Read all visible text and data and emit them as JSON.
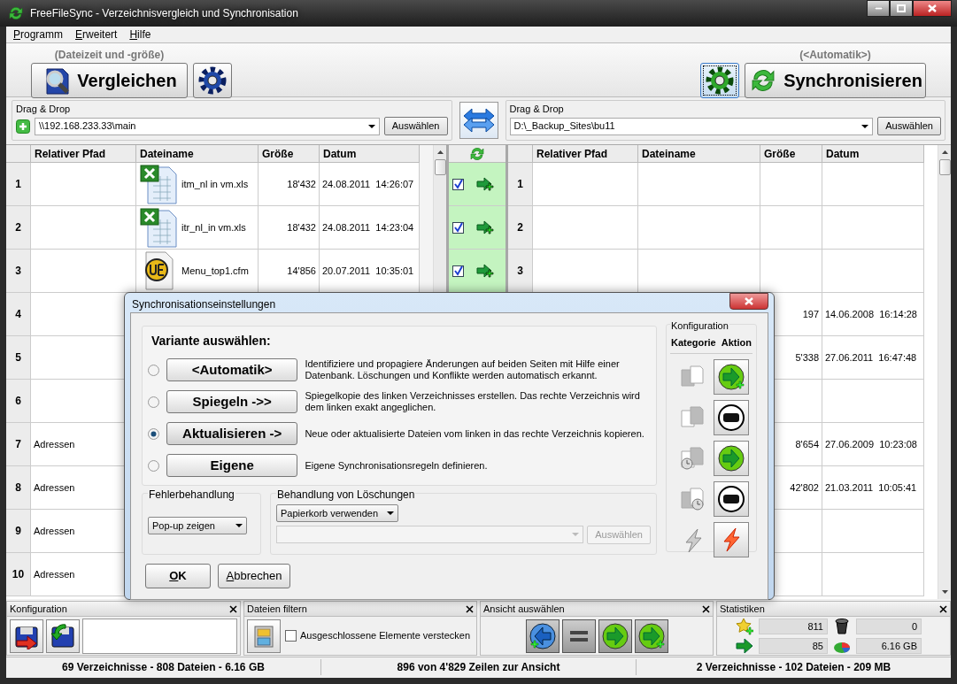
{
  "window": {
    "title": "FreeFileSync - Verzeichnisvergleich und Synchronisation"
  },
  "menu": [
    {
      "label": "Programm"
    },
    {
      "label": "Erweitert"
    },
    {
      "label": "Hilfe"
    }
  ],
  "toolbar": {
    "compare_hint": "(Dateizeit und -größe)",
    "compare_button": "Vergleichen",
    "sync_hint": "(<Automatik>)",
    "sync_button": "Synchronisieren"
  },
  "folders": {
    "left": {
      "label": "Drag & Drop",
      "path": "\\\\192.168.233.33\\main",
      "button": "Auswählen"
    },
    "right": {
      "label": "Drag & Drop",
      "path": "D:\\_Backup_Sites\\bu11",
      "button": "Auswählen"
    }
  },
  "grid": {
    "left_columns": [
      "Relativer Pfad",
      "Dateiname",
      "Größe",
      "Datum"
    ],
    "right_columns": [
      "Relativer Pfad",
      "Dateiname",
      "Größe",
      "Datum"
    ],
    "rows": [
      {
        "left_number": "1",
        "file_icon": {
          "kind": "excel"
        },
        "file_name": "itm_nl in vm.xls",
        "size": "18'432",
        "date": "24.08.2011  14:26:07",
        "checked": true,
        "action": {
          "kind": "create-right"
        },
        "right_number": "1"
      },
      {
        "left_number": "2",
        "file_icon": {
          "kind": "excel"
        },
        "file_name": "itr_nl_in vm.xls",
        "size": "18'432",
        "date": "24.08.2011  14:23:04",
        "checked": true,
        "action": {
          "kind": "create-right"
        },
        "right_number": "2"
      },
      {
        "left_number": "3",
        "file_icon": {
          "kind": "ultraedit"
        },
        "file_name": "Menu_top1.cfm",
        "size": "14'856",
        "date": "20.07.2011  10:35:01",
        "checked": true,
        "action": {
          "kind": "create-right"
        },
        "right_number": "3"
      },
      {
        "left_number": "4",
        "right_size": "197",
        "right_date": "14.06.2008  16:14:28"
      },
      {
        "left_number": "5",
        "right_size": "5'338",
        "right_date": "27.06.2011  16:47:48"
      },
      {
        "left_number": "6"
      },
      {
        "left_number": "7",
        "left_path": "Adressen",
        "right_size": "8'654",
        "right_date": "27.06.2009  10:23:08"
      },
      {
        "left_number": "8",
        "left_path": "Adressen",
        "right_size": "42'802",
        "right_date": "21.03.2011  10:05:41"
      },
      {
        "left_number": "9",
        "left_path": "Adressen"
      },
      {
        "left_number": "10",
        "left_path": "Adressen"
      }
    ]
  },
  "dialog": {
    "title": "Synchronisationseinstellungen",
    "heading": "Variante auswählen:",
    "variants": [
      {
        "label": "<Automatik>",
        "description": "Identifiziere und propagiere Änderungen auf beiden Seiten mit Hilfe einer Datenbank. Löschungen und Konflikte werden automatisch erkannt.",
        "selected": false
      },
      {
        "label": "Spiegeln ->>",
        "description": "Spiegelkopie des linken Verzeichnisses erstellen. Das rechte Verzeichnis wird dem linken exakt angeglichen.",
        "selected": false
      },
      {
        "label": "Aktualisieren ->",
        "description": "Neue oder aktualisierte Dateien vom linken in das rechte Verzeichnis kopieren.",
        "selected": true
      },
      {
        "label": "Eigene",
        "description": "Eigene Synchronisationsregeln definieren.",
        "selected": false
      }
    ],
    "error_handling": {
      "label": "Fehlerbehandlung",
      "value": "Pop-up zeigen"
    },
    "deletion": {
      "label": "Behandlung von Löschungen",
      "value": "Papierkorb verwenden",
      "button": "Auswählen",
      "disabled": true
    },
    "config": {
      "label": "Konfiguration",
      "columns": [
        "Kategorie",
        "Aktion"
      ],
      "rules": [
        {
          "category": {
            "kind": "left-only"
          },
          "action": {
            "kind": "copy-new"
          }
        },
        {
          "category": {
            "kind": "right-only"
          },
          "action": {
            "kind": "delete"
          }
        },
        {
          "category": {
            "kind": "left-newer"
          },
          "action": {
            "kind": "copy"
          }
        },
        {
          "category": {
            "kind": "right-newer"
          },
          "action": {
            "kind": "delete"
          }
        },
        {
          "category": {
            "kind": "conflict"
          },
          "action": {
            "kind": "conflict"
          }
        }
      ]
    },
    "buttons": [
      "OK",
      "Abbrechen"
    ]
  },
  "panels": {
    "config": {
      "title": "Konfiguration"
    },
    "filter": {
      "title": "Dateien filtern",
      "checkbox": "Ausgeschlossene Elemente verstecken",
      "checked": false
    },
    "view": {
      "title": "Ansicht auswählen",
      "buttons": [
        {
          "kind": "create-left"
        },
        {
          "kind": "equal"
        },
        {
          "kind": "update-right"
        },
        {
          "kind": "create-right"
        }
      ]
    },
    "stats": {
      "title": "Statistiken",
      "values": [
        {
          "kind": "create",
          "value": "811"
        },
        {
          "kind": "delete",
          "value": "0"
        },
        {
          "kind": "update",
          "value": "85"
        },
        {
          "kind": "data",
          "value": "6.16 GB"
        }
      ]
    }
  },
  "status_bar": [
    "69 Verzeichnisse - 808 Dateien - 6.16 GB",
    "896 von 4'829 Zeilen zur Ansicht",
    "2 Verzeichnisse - 102 Dateien - 209 MB"
  ]
}
